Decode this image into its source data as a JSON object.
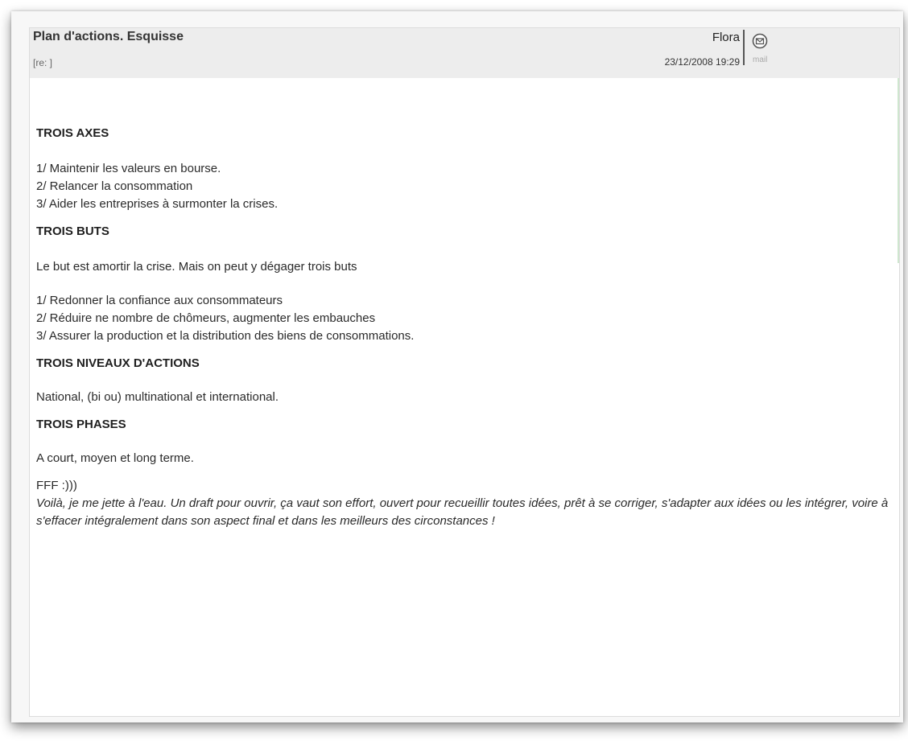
{
  "message": {
    "subject": "Plan d'actions. Esquisse",
    "reply_tag": "[re: ]",
    "author": "Flora",
    "date": "23/12/2008 19:29",
    "mail_label": "mail",
    "mail_icon": "mail-icon"
  },
  "content": {
    "axes_heading": "TROIS AXES",
    "axes": [
      "1/ Maintenir les valeurs en bourse.",
      "2/ Relancer la consommation",
      "3/ Aider les entreprises à surmonter la crises."
    ],
    "buts_heading": "TROIS BUTS",
    "buts_intro": "Le but est amortir la crise. Mais on peut y dégager trois buts",
    "buts": [
      "1/ Redonner la confiance aux consommateurs",
      "2/ Réduire ne nombre de chômeurs, augmenter les embauches",
      "3/ Assurer la production et la distribution des biens de consommations."
    ],
    "niveaux_heading": "TROIS NIVEAUX D'ACTIONS",
    "niveaux_text": "National, (bi ou) multinational et international.",
    "phases_heading": "TROIS PHASES",
    "phases_text": "A court, moyen et long terme.",
    "signature": "FFF :)))",
    "closing": "Voilà, je me jette à l'eau. Un draft pour ouvrir, ça vaut son effort, ouvert pour recueillir toutes idées, prêt à se corriger, s'adapter aux idées ou les intégrer, voire à s'effacer intégralement dans son aspect final et dans les meilleurs des circonstances !"
  }
}
